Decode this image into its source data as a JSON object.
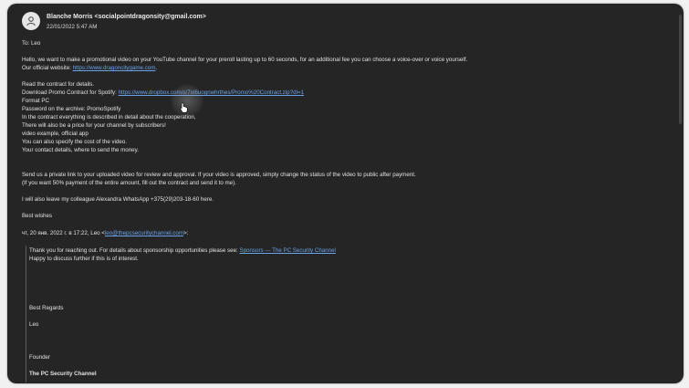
{
  "sender": {
    "name": "Blanche Morris <socialpointdragonsity@gmail.com>",
    "date": "22/01/2022 5:47 AM"
  },
  "email": {
    "to": "To: Leo",
    "p1_line1": "Hello, we want to make a promotional video on your YouTube channel for your preroll lasting up to 60 seconds, for an additional fee you can choose a voice-over or voice yourself.",
    "p1_line2_prefix": "Our official website: ",
    "website_link": "https://www.dragoncitygame.com",
    "p1_line2_suffix": ".",
    "read_contract": "Read the contract for details.",
    "download_prefix": "Download Promo Contract for Spotify: ",
    "download_link": "https://www.dropbox.com/s/7xt6uognwhrthes/Promo%20Contract.zip?dl=1",
    "format": "Format PC",
    "password": "Password on the archive: PromoSpotify",
    "contract_line": "In the contract everything is described in detail about the cooperation,",
    "price_line": "There will also be a price for your channel by subscribers!",
    "video_example": "video example, official app",
    "cost_line": "You can also specify the cost of the video.",
    "contact_line": "Your contact details, where to send the money.",
    "private_link_line": "Send us a private link to your uploaded video for review and approval. If your video is approved, simply change the status of the video to public after payment.",
    "payment_line": "(If you want 50% payment of the entire amount, fill out the contract and send it to me).",
    "whatsapp_line": "I will also leave my colleague Alexandra WhatsApp +375(29)203-18-60 here.",
    "best_wishes": "Best wishes"
  },
  "reply_header": {
    "prefix": "чт, 20 янв. 2022 г. в 17:22, Leo <",
    "email_link": "leo@thepcsecuritychannel.com",
    "suffix": ">:"
  },
  "quote": {
    "thanks_prefix": "Thank you for reaching out. For details about sponsorship opportunities please see: ",
    "sponsors_link": "Sponsors — The PC Security Channel",
    "happy_line": "Happy to discuss further if this is of interest.",
    "best_regards": "Best Regards",
    "name": "Leo",
    "title": "Founder",
    "company": "The PC Security Channel"
  },
  "colors": {
    "background": "#252525",
    "link": "#6aa2e8",
    "text": "#e2e2e2"
  },
  "icons": {
    "avatar": "person-icon",
    "pointer": "hand-pointer-icon"
  }
}
